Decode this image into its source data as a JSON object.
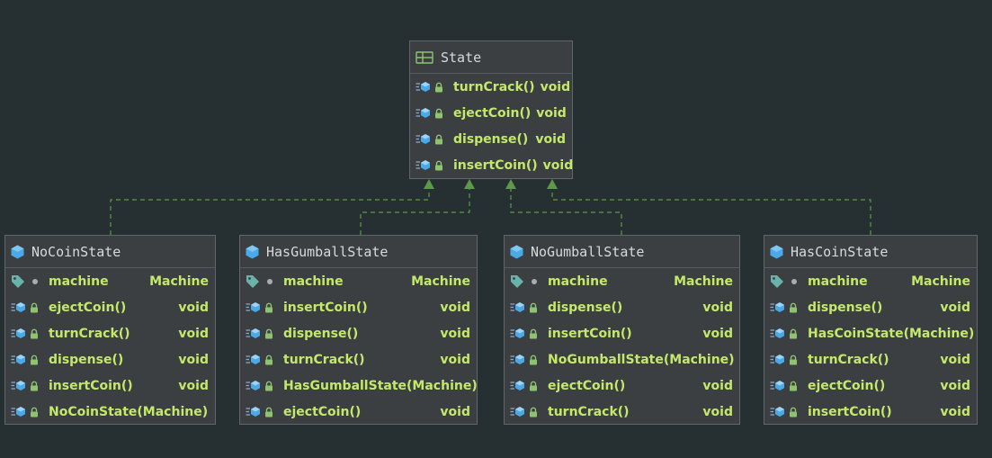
{
  "colors": {
    "background": "#263033",
    "box_fill": "#3b3f42",
    "member_text": "#c4e86a",
    "title_text": "#d7dadc",
    "edge": "#5c9a45",
    "class_icon": "#4aa9e6",
    "field_icon": "#6ab3a8"
  },
  "interface": {
    "name": "State",
    "icon": "interface-icon",
    "methods": [
      {
        "name": "turnCrack()",
        "type": "void"
      },
      {
        "name": "ejectCoin()",
        "type": "void"
      },
      {
        "name": "dispense()",
        "type": "void"
      },
      {
        "name": "insertCoin()",
        "type": "void"
      }
    ]
  },
  "classes": [
    {
      "name": "NoCoinState",
      "icon": "class-icon",
      "field": {
        "name": "machine",
        "type": "Machine"
      },
      "methods": [
        {
          "name": "ejectCoin()",
          "type": "void"
        },
        {
          "name": "turnCrack()",
          "type": "void"
        },
        {
          "name": "dispense()",
          "type": "void"
        },
        {
          "name": "insertCoin()",
          "type": "void"
        },
        {
          "name": "NoCoinState(Machine)",
          "type": ""
        }
      ]
    },
    {
      "name": "HasGumballState",
      "icon": "class-icon",
      "field": {
        "name": "machine",
        "type": "Machine"
      },
      "methods": [
        {
          "name": "insertCoin()",
          "type": "void"
        },
        {
          "name": "dispense()",
          "type": "void"
        },
        {
          "name": "turnCrack()",
          "type": "void"
        },
        {
          "name": "HasGumballState(Machine)",
          "type": ""
        },
        {
          "name": "ejectCoin()",
          "type": "void"
        }
      ]
    },
    {
      "name": "NoGumballState",
      "icon": "class-icon",
      "field": {
        "name": "machine",
        "type": "Machine"
      },
      "methods": [
        {
          "name": "dispense()",
          "type": "void"
        },
        {
          "name": "insertCoin()",
          "type": "void"
        },
        {
          "name": "NoGumballState(Machine)",
          "type": ""
        },
        {
          "name": "ejectCoin()",
          "type": "void"
        },
        {
          "name": "turnCrack()",
          "type": "void"
        }
      ]
    },
    {
      "name": "HasCoinState",
      "icon": "class-icon",
      "field": {
        "name": "machine",
        "type": "Machine"
      },
      "methods": [
        {
          "name": "dispense()",
          "type": "void"
        },
        {
          "name": "HasCoinState(Machine)",
          "type": ""
        },
        {
          "name": "turnCrack()",
          "type": "void"
        },
        {
          "name": "ejectCoin()",
          "type": "void"
        },
        {
          "name": "insertCoin()",
          "type": "void"
        }
      ]
    }
  ]
}
